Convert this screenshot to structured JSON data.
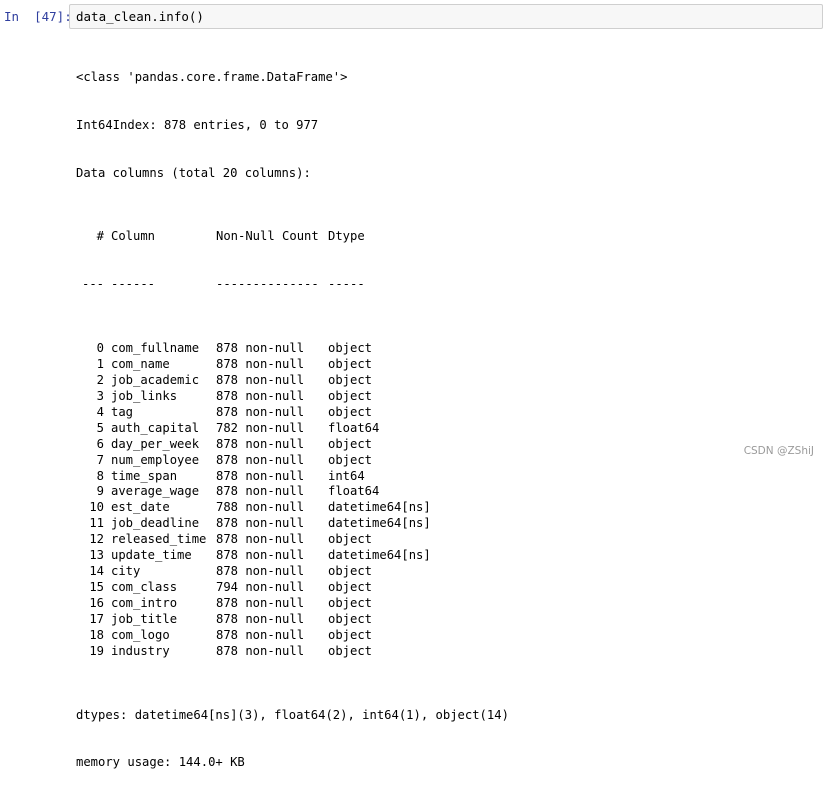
{
  "cell": {
    "prompt": "In  [47]:",
    "code": "data_clean.info()"
  },
  "output": {
    "class_line": "<class 'pandas.core.frame.DataFrame'>",
    "index_line": "Int64Index: 878 entries, 0 to 977",
    "columns_line": "Data columns (total 20 columns):",
    "header": {
      "idx": "#",
      "column": "Column",
      "non_null": "Non-Null Count",
      "dtype": "Dtype"
    },
    "separator": {
      "idx": "---",
      "column": "------",
      "non_null": "--------------",
      "dtype": "-----"
    },
    "rows": [
      {
        "idx": "0",
        "column": "com_fullname",
        "non_null": "878 non-null",
        "dtype": "object"
      },
      {
        "idx": "1",
        "column": "com_name",
        "non_null": "878 non-null",
        "dtype": "object"
      },
      {
        "idx": "2",
        "column": "job_academic",
        "non_null": "878 non-null",
        "dtype": "object"
      },
      {
        "idx": "3",
        "column": "job_links",
        "non_null": "878 non-null",
        "dtype": "object"
      },
      {
        "idx": "4",
        "column": "tag",
        "non_null": "878 non-null",
        "dtype": "object"
      },
      {
        "idx": "5",
        "column": "auth_capital",
        "non_null": "782 non-null",
        "dtype": "float64"
      },
      {
        "idx": "6",
        "column": "day_per_week",
        "non_null": "878 non-null",
        "dtype": "object"
      },
      {
        "idx": "7",
        "column": "num_employee",
        "non_null": "878 non-null",
        "dtype": "object"
      },
      {
        "idx": "8",
        "column": "time_span",
        "non_null": "878 non-null",
        "dtype": "int64"
      },
      {
        "idx": "9",
        "column": "average_wage",
        "non_null": "878 non-null",
        "dtype": "float64"
      },
      {
        "idx": "10",
        "column": "est_date",
        "non_null": "788 non-null",
        "dtype": "datetime64[ns]"
      },
      {
        "idx": "11",
        "column": "job_deadline",
        "non_null": "878 non-null",
        "dtype": "datetime64[ns]"
      },
      {
        "idx": "12",
        "column": "released_time",
        "non_null": "878 non-null",
        "dtype": "object"
      },
      {
        "idx": "13",
        "column": "update_time",
        "non_null": "878 non-null",
        "dtype": "datetime64[ns]"
      },
      {
        "idx": "14",
        "column": "city",
        "non_null": "878 non-null",
        "dtype": "object"
      },
      {
        "idx": "15",
        "column": "com_class",
        "non_null": "794 non-null",
        "dtype": "object"
      },
      {
        "idx": "16",
        "column": "com_intro",
        "non_null": "878 non-null",
        "dtype": "object"
      },
      {
        "idx": "17",
        "column": "job_title",
        "non_null": "878 non-null",
        "dtype": "object"
      },
      {
        "idx": "18",
        "column": "com_logo",
        "non_null": "878 non-null",
        "dtype": "object"
      },
      {
        "idx": "19",
        "column": "industry",
        "non_null": "878 non-null",
        "dtype": "object"
      }
    ],
    "dtypes_line": "dtypes: datetime64[ns](3), float64(2), int64(1), object(14)",
    "memory_line": "memory usage: 144.0+ KB"
  },
  "watermark": "CSDN @ZShiJ"
}
